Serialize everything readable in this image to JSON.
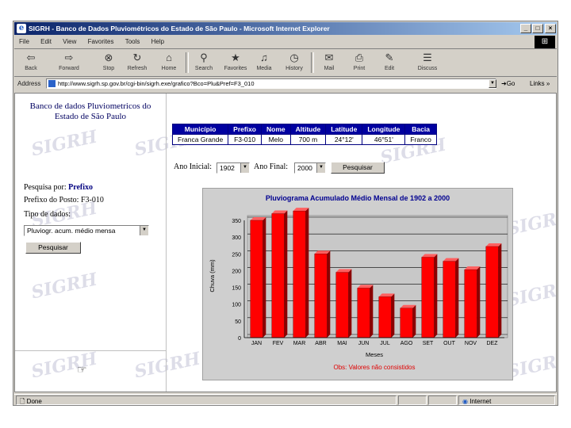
{
  "window": {
    "title": "SIGRH - Banco de Dados Pluviométricos do Estado de São Paulo - Microsoft Internet Explorer",
    "controls": [
      "_",
      "□",
      "×"
    ]
  },
  "menu": [
    "File",
    "Edit",
    "View",
    "Favorites",
    "Tools",
    "Help"
  ],
  "toolbar": {
    "buttons": [
      {
        "label": "Back",
        "icon": "back-arrow-icon",
        "glyph": "⇦"
      },
      {
        "label": "Forward",
        "icon": "forward-arrow-icon",
        "glyph": "⇨"
      },
      {
        "label": "Stop",
        "icon": "stop-icon",
        "glyph": "⊗"
      },
      {
        "label": "Refresh",
        "icon": "refresh-icon",
        "glyph": "↻"
      },
      {
        "label": "Home",
        "icon": "home-icon",
        "glyph": "⌂"
      },
      {
        "label": "Search",
        "icon": "search-icon",
        "glyph": "⚲"
      },
      {
        "label": "Favorites",
        "icon": "favorites-icon",
        "glyph": "★"
      },
      {
        "label": "Media",
        "icon": "media-icon",
        "glyph": "♫"
      },
      {
        "label": "History",
        "icon": "history-icon",
        "glyph": "◷"
      },
      {
        "label": "Mail",
        "icon": "mail-icon",
        "glyph": "✉"
      },
      {
        "label": "Print",
        "icon": "print-icon",
        "glyph": "⎙"
      },
      {
        "label": "Edit",
        "icon": "edit-icon",
        "glyph": "✎"
      },
      {
        "label": "Discuss",
        "icon": "discuss-icon",
        "glyph": "☰"
      }
    ]
  },
  "address": {
    "label": "Address",
    "url": "http://www.sigrh.sp.gov.br/cgi-bin/sigrh.exe/grafico?Bco=Plu&Pref=F3_010",
    "go_label": "Go",
    "links_label": "Links »"
  },
  "left_panel": {
    "title": "Banco de dados Pluviometricos do Estado de São Paulo",
    "search_by_label": "Pesquisa por:",
    "search_by_value": "Prefixo",
    "station_label": "Prefixo do Posto: F3-010",
    "data_type_label": "Tipo de dados:",
    "data_type_value": "Pluviogr. acum. médio mensa",
    "search_button": "Pesquisar"
  },
  "station_table": {
    "headers": [
      "Município",
      "Prefixo",
      "Nome",
      "Altitude",
      "Latitude",
      "Longitude",
      "Bacia"
    ],
    "row": [
      "Franca Grande",
      "F3-010",
      "Melo",
      "700 m",
      "24°12'",
      "46°51'",
      "Franco"
    ]
  },
  "year_filter": {
    "start_label": "Ano Inicial:",
    "start_value": "1902",
    "end_label": "Ano Final:",
    "end_value": "2000",
    "search_button": "Pesquisar"
  },
  "chart_data": {
    "type": "bar",
    "title": "Pluviograma Acumulado Médio Mensal de 1902 a 2000",
    "xlabel": "Meses",
    "ylabel": "Chuva (mm)",
    "categories": [
      "JAN",
      "FEV",
      "MAR",
      "ABR",
      "MAI",
      "JUN",
      "JUL",
      "AGO",
      "SET",
      "OUT",
      "NOV",
      "DEZ"
    ],
    "values": [
      350,
      370,
      378,
      250,
      195,
      148,
      122,
      88,
      240,
      228,
      203,
      272
    ],
    "ylim": [
      0,
      350
    ],
    "yticks": [
      0,
      50,
      100,
      150,
      200,
      250,
      300,
      350
    ],
    "grid": true,
    "note": "Obs: Valores não consistidos",
    "colors": {
      "bar": "#ff0000",
      "bar_side": "#8b0000",
      "title": "#000090",
      "note": "#e00000"
    }
  },
  "statusbar": {
    "status": "Done",
    "zone": "Internet"
  }
}
